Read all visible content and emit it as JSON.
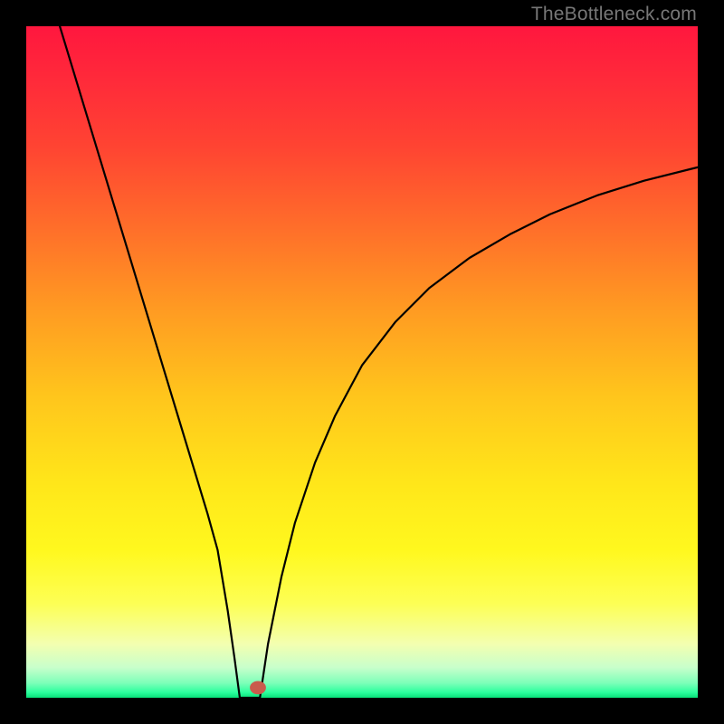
{
  "watermark": "TheBottleneck.com",
  "chart_data": {
    "type": "line",
    "title": "",
    "xlabel": "",
    "ylabel": "",
    "xlim": [
      0,
      100
    ],
    "ylim": [
      0,
      100
    ],
    "grid": false,
    "legend": false,
    "gradient_stops": [
      {
        "offset": 0.0,
        "color": "#ff173e"
      },
      {
        "offset": 0.08,
        "color": "#ff2a3a"
      },
      {
        "offset": 0.18,
        "color": "#ff4432"
      },
      {
        "offset": 0.3,
        "color": "#ff6e2a"
      },
      {
        "offset": 0.42,
        "color": "#ff9a22"
      },
      {
        "offset": 0.55,
        "color": "#ffc51c"
      },
      {
        "offset": 0.68,
        "color": "#ffe61a"
      },
      {
        "offset": 0.78,
        "color": "#fff81e"
      },
      {
        "offset": 0.86,
        "color": "#fdff55"
      },
      {
        "offset": 0.92,
        "color": "#f3ffb0"
      },
      {
        "offset": 0.955,
        "color": "#c8ffcb"
      },
      {
        "offset": 0.978,
        "color": "#7dffb9"
      },
      {
        "offset": 0.992,
        "color": "#2bff9d"
      },
      {
        "offset": 1.0,
        "color": "#08e079"
      }
    ],
    "series": [
      {
        "name": "left-branch",
        "x": [
          5.0,
          7.0,
          9.0,
          11.0,
          13.0,
          15.0,
          17.0,
          19.0,
          21.0,
          23.0,
          25.0,
          27.0,
          28.5,
          30.0,
          31.0,
          31.8
        ],
        "y": [
          100.0,
          93.4,
          86.8,
          80.2,
          73.6,
          67.0,
          60.4,
          53.8,
          47.2,
          40.6,
          34.0,
          27.4,
          22.0,
          13.0,
          6.0,
          0.0
        ]
      },
      {
        "name": "valley-floor",
        "x": [
          31.8,
          33.2,
          34.8
        ],
        "y": [
          0.0,
          0.0,
          0.0
        ]
      },
      {
        "name": "right-branch",
        "x": [
          34.8,
          36.0,
          38.0,
          40.0,
          43.0,
          46.0,
          50.0,
          55.0,
          60.0,
          66.0,
          72.0,
          78.0,
          85.0,
          92.0,
          100.0
        ],
        "y": [
          0.0,
          8.0,
          18.0,
          26.0,
          35.0,
          42.0,
          49.5,
          56.0,
          61.0,
          65.5,
          69.0,
          72.0,
          74.8,
          77.0,
          79.0
        ]
      }
    ],
    "marker": {
      "name": "valley-marker",
      "x": 34.5,
      "y": 1.5,
      "rx": 1.2,
      "ry": 1.0,
      "color": "#c95c4d"
    }
  }
}
